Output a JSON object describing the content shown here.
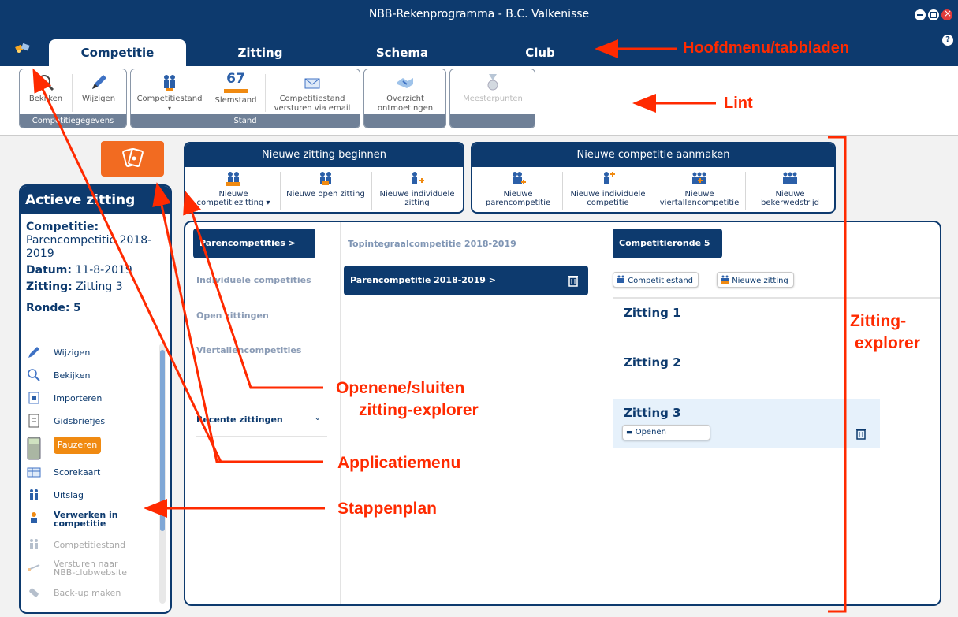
{
  "window": {
    "title": "NBB-Rekenprogramma - B.C. Valkenisse"
  },
  "tabs": [
    {
      "label": "Competitie",
      "active": true
    },
    {
      "label": "Zitting"
    },
    {
      "label": "Schema"
    },
    {
      "label": "Club"
    }
  ],
  "ribbon": {
    "groups": [
      {
        "label": "Competitiegegevens",
        "buttons": [
          "Bekijken",
          "Wijzigen"
        ]
      },
      {
        "label": "Stand",
        "buttons": [
          "Competitiestand",
          "Slemstand",
          "Competitiestand versturen via email"
        ],
        "slemstand_number": "67"
      },
      {
        "buttons": [
          "Overzicht ontmoetingen"
        ]
      },
      {
        "buttons": [
          "Meesterpunten"
        ]
      }
    ]
  },
  "new_session": {
    "title": "Nieuwe zitting beginnen",
    "buttons": [
      "Nieuwe competitiezitting ▾",
      "Nieuwe open zitting",
      "Nieuwe individuele zitting"
    ]
  },
  "new_competition": {
    "title": "Nieuwe competitie aanmaken",
    "buttons": [
      "Nieuwe parencompetitie",
      "Nieuwe individuele competitie",
      "Nieuwe viertallencompetitie",
      "Nieuwe bekerwedstrijd"
    ]
  },
  "active_session": {
    "title": "Actieve zitting",
    "competitie_label": "Competitie:",
    "competitie_value": "Parencompetitie 2018-2019",
    "datum_label": "Datum:",
    "datum_value": "11-8-2019",
    "zitting_label": "Zitting:",
    "zitting_value": "Zitting 3",
    "ronde_label": "Ronde:",
    "ronde_value": "5",
    "steps": [
      {
        "label": "Wijzigen",
        "icon": "pencil-icon"
      },
      {
        "label": "Bekijken",
        "icon": "magnifier-icon"
      },
      {
        "label": "Importeren",
        "icon": "import-icon"
      },
      {
        "label": "Gidsbriefjes",
        "icon": "document-icon"
      },
      {
        "label": "Pauzeren",
        "icon": "calculator-icon"
      },
      {
        "label": "Scorekaart",
        "icon": "scorecard-icon"
      },
      {
        "label": "Uitslag",
        "icon": "players-icon"
      },
      {
        "label": "Verwerken in competitie",
        "icon": "process-icon"
      },
      {
        "label": "Competitiestand",
        "icon": "players-icon",
        "disabled": true
      },
      {
        "label": "Versturen naar NBB-clubwebsite",
        "icon": "send-icon",
        "disabled": true
      },
      {
        "label": "Back-up maken",
        "icon": "backup-icon",
        "disabled": true
      }
    ]
  },
  "explorer": {
    "categories": [
      {
        "label": "Parencompetities >",
        "selected": true
      },
      {
        "label": "Individuele competities"
      },
      {
        "label": "Open zittingen"
      },
      {
        "label": "Viertallencompetities"
      }
    ],
    "recent_label": "Recente zittingen",
    "competitions": [
      {
        "label": "Topintegraalcompetitie 2018-2019"
      },
      {
        "label": "Parencompetitie 2018-2019 >",
        "selected": true
      }
    ],
    "round_select": "Competitieronde 5",
    "actions": [
      "Competitiestand",
      "Nieuwe zitting"
    ],
    "sessions": [
      {
        "label": "Zitting 1"
      },
      {
        "label": "Zitting 2"
      },
      {
        "label": "Zitting 3",
        "selected": true,
        "open_label": "Openen"
      }
    ]
  },
  "annotations": {
    "hoofdmenu": "Hoofdmenu/tabbladen",
    "lint": "Lint",
    "zitting_explorer_line1": "Zitting-",
    "zitting_explorer_line2": "explorer",
    "openen_line1": "Openene/sluiten",
    "openen_line2": "zitting-explorer",
    "applicatiemenu": "Applicatiemenu",
    "stappenplan": "Stappenplan"
  },
  "colors": {
    "navy": "#0d3a6e",
    "orange": "#f26b21",
    "annotation": "#ff2a00"
  }
}
